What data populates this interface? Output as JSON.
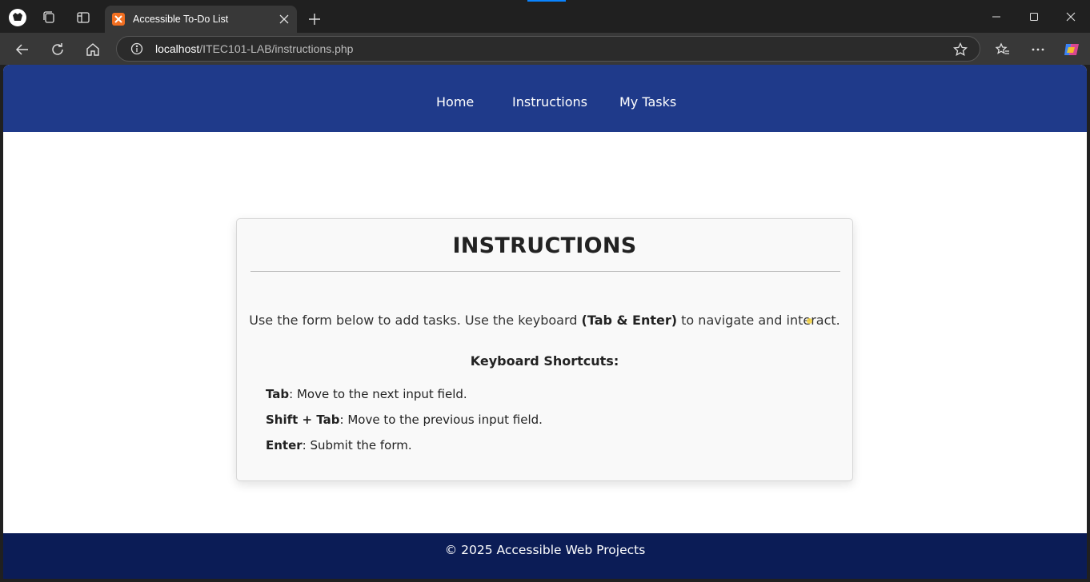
{
  "browser": {
    "tab_title": "Accessible To-Do List",
    "url_host": "localhost",
    "url_path": "/ITEC101-LAB/instructions.php",
    "icons": [
      "profile-icon",
      "workspaces-icon",
      "tab-actions-icon",
      "favicon-xampp-icon",
      "close-icon",
      "new-tab-icon",
      "minimize-icon",
      "maximize-icon",
      "window-close-icon",
      "back-icon",
      "refresh-icon",
      "home-icon",
      "site-info-icon",
      "favorite-star-icon",
      "favorites-icon",
      "more-icon",
      "copilot-icon"
    ]
  },
  "site": {
    "nav": {
      "home": "Home",
      "instructions": "Instructions",
      "tasks": "My Tasks"
    },
    "colors": {
      "header": "#1f3a8a",
      "footer": "#0b1c56"
    }
  },
  "card": {
    "title": "INSTRUCTIONS",
    "intro_before": "Use the form below to add tasks. Use the keyboard ",
    "intro_bold": "(Tab & Enter)",
    "intro_after": " to navigate and interact.",
    "subhead": "Keyboard Shortcuts:",
    "shortcuts": [
      {
        "key": "Tab",
        "desc": ": Move to the next input field."
      },
      {
        "key": "Shift + Tab",
        "desc": ": Move to the previous input field."
      },
      {
        "key": "Enter",
        "desc": ": Submit the form."
      }
    ]
  },
  "footer": {
    "text": "© 2025 Accessible Web Projects"
  }
}
